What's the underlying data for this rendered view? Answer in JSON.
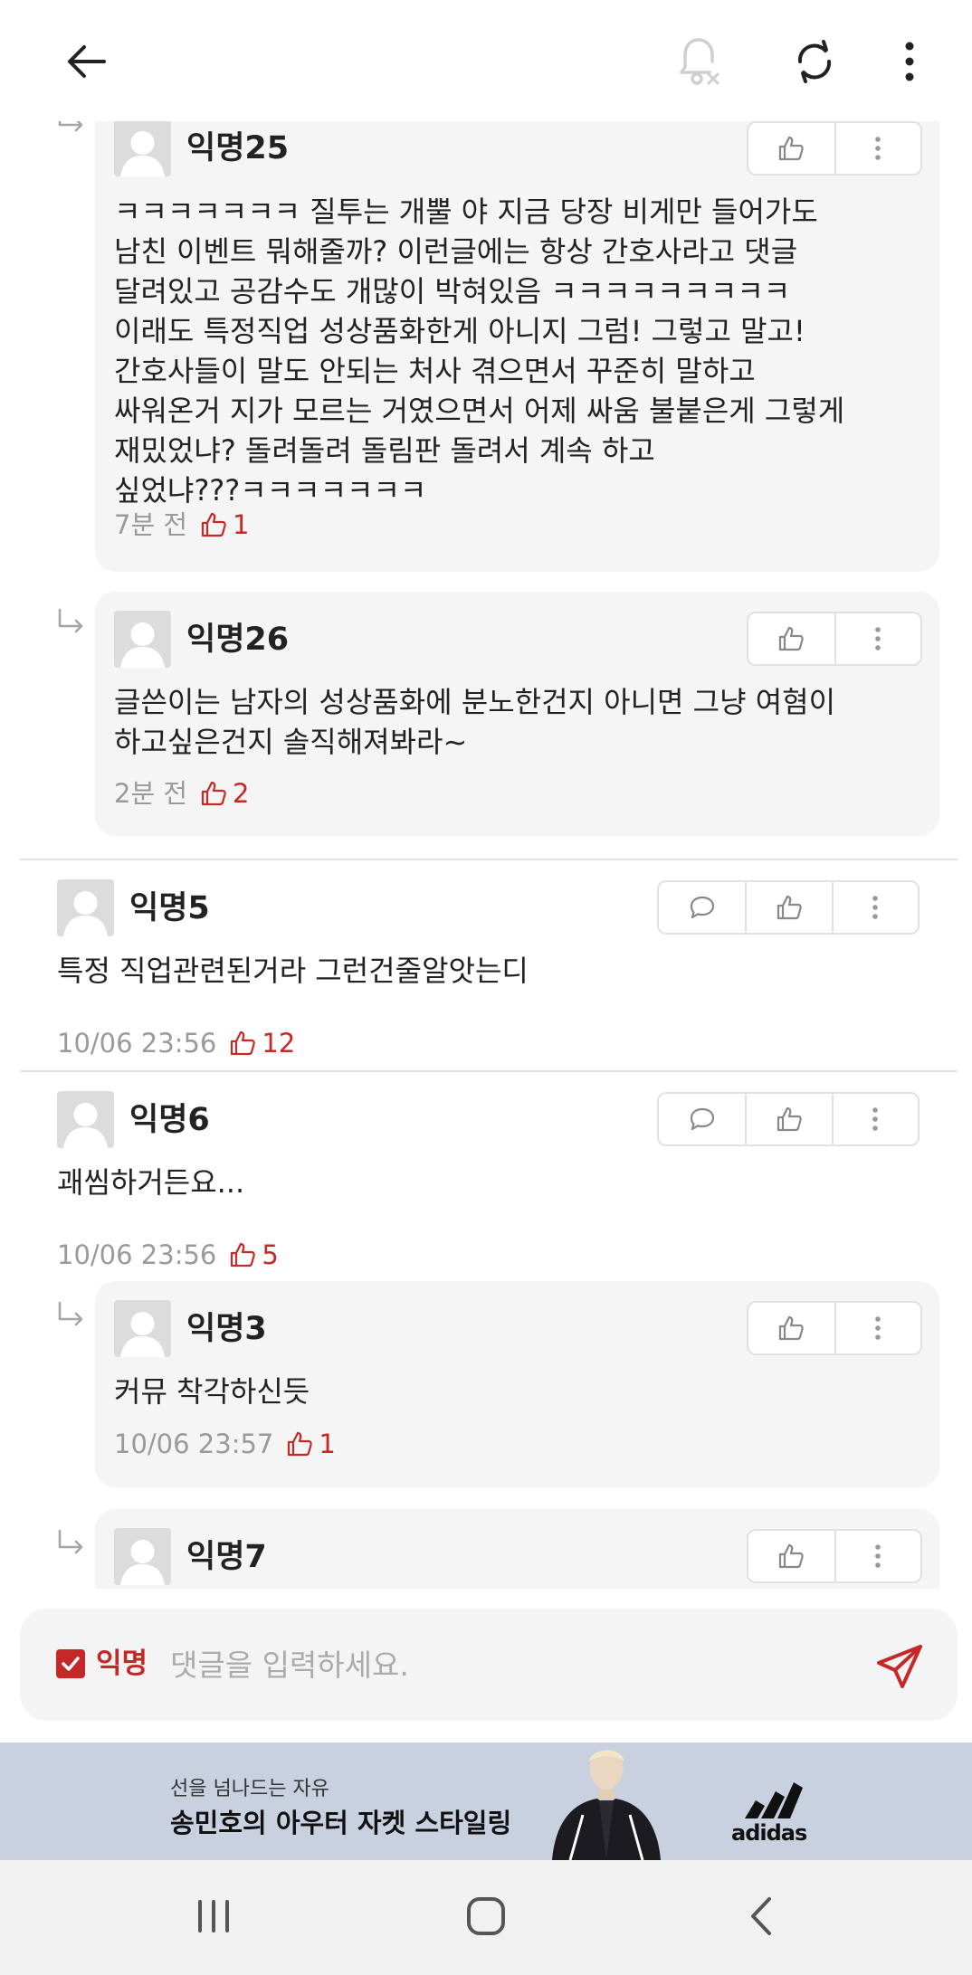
{
  "toolbar": {
    "back_icon": "arrow-left-icon",
    "notification_icon": "bell-off-icon",
    "refresh_icon": "refresh-icon",
    "more_icon": "more-vertical-icon"
  },
  "comments": [
    {
      "kind": "reply",
      "author": "익명25",
      "text": "ㅋㅋㅋㅋㅋㅋㅋ 질투는 개뿔 야 지금 당장 비게만 들어가도\n남친 이벤트 뭐해줄까? 이런글에는 항상 간호사라고 댓글\n달려있고 공감수도 개많이 박혀있음 ㅋㅋㅋㅋㅋㅋㅋㅋㅋ\n이래도 특정직업 성상품화한게 아니지 그럼! 그렇고 말고!\n간호사들이 말도 안되는 처사 겪으면서 꾸준히 말하고\n싸워온거 지가 모르는 거였으면서 어제 싸움 불붙은게 그렇게\n재밌었냐? 돌려돌려 돌림판 돌려서 계속 하고\n싶었냐???ㅋㅋㅋㅋㅋㅋㅋ",
      "time": "7분 전",
      "likes": "1"
    },
    {
      "kind": "reply",
      "author": "익명26",
      "text": "글쓴이는 남자의 성상품화에 분노한건지 아니면 그냥 여혐이\n하고싶은건지 솔직해져봐라~",
      "time": "2분 전",
      "likes": "2"
    },
    {
      "kind": "comment",
      "author": "익명5",
      "text": "특정 직업관련된거라 그런건줄알앗는디",
      "time": "10/06 23:56",
      "likes": "12"
    },
    {
      "kind": "comment",
      "author": "익명6",
      "text": "괘씸하거든요...",
      "time": "10/06 23:56",
      "likes": "5"
    },
    {
      "kind": "reply",
      "author": "익명3",
      "text": "커뮤 착각하신듯",
      "time": "10/06 23:57",
      "likes": "1"
    },
    {
      "kind": "reply",
      "author": "익명7",
      "text": "",
      "time": "",
      "likes": ""
    }
  ],
  "input": {
    "anonymous_label": "익명",
    "anonymous_checked": true,
    "placeholder": "댓글을 입력하세요.",
    "value": ""
  },
  "ad": {
    "subtitle": "선을 넘나드는 자유",
    "headline": "송민호의 아우터 자켓 스타일링",
    "brand": "adidas"
  },
  "system_nav": {
    "recents_icon": "recents-icon",
    "home_icon": "home-icon",
    "back_icon": "back-chevron-icon"
  },
  "colors": {
    "accent": "#c62828",
    "reply_background": "#f5f5f5",
    "meta_gray": "#9a9a9a",
    "ad_background": "#c9d1e0"
  }
}
